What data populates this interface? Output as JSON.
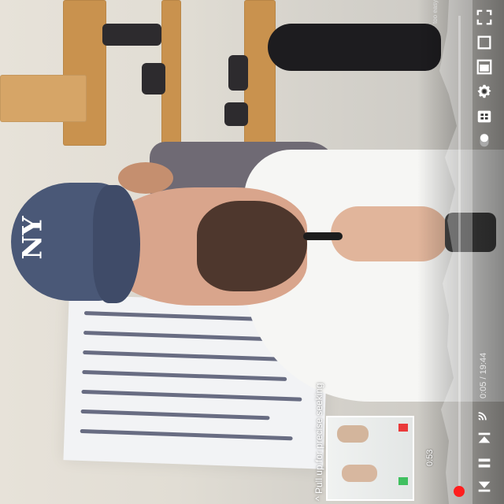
{
  "player": {
    "seek_hint": "^ Pull up for precise seeking",
    "preview_time": "0:53",
    "timecode": "0:05 / 19:44",
    "channel_label": "too easy!",
    "progress": 0.005
  },
  "colors": {
    "accent": "#ff1e1e",
    "icon": "#ffffff"
  },
  "icons": [
    "fullscreen-icon",
    "miniplayer-icon",
    "theater-icon",
    "settings-icon",
    "captions-icon",
    "autoplay-icon",
    "cast-icon",
    "previous-icon",
    "pause-icon",
    "next-icon"
  ]
}
